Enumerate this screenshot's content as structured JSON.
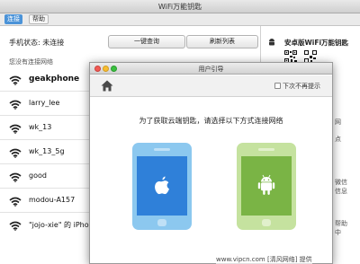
{
  "window": {
    "title": "WiFi万能钥匙"
  },
  "toolbar": {
    "tabs": [
      {
        "label": "连接"
      },
      {
        "label": "帮助"
      }
    ]
  },
  "main": {
    "status_text": "手机状态: 未连接",
    "query_button": "一键查询",
    "refresh_button": "刷新列表",
    "subheading": "您没有连接网络",
    "networks": [
      {
        "ssid": "geakphone"
      },
      {
        "ssid": "larry_lee"
      },
      {
        "ssid": "wk_13"
      },
      {
        "ssid": "wk_13_5g"
      },
      {
        "ssid": "good"
      },
      {
        "ssid": "modou-A157"
      },
      {
        "ssid": "\"jojo-xie\" 的 iPho"
      }
    ]
  },
  "sidebar": {
    "title": "安卓版WiFi万能钥匙",
    "fragments": [
      "网",
      "点",
      "微信",
      "信息",
      "帮助",
      "中"
    ]
  },
  "dialog": {
    "title": "用户引导",
    "dont_show_again": "下次不再提示",
    "instruction": "为了获取云端钥匙，请选择以下方式连接网络"
  },
  "watermark": "www.vipcn.com [清风网络] 提供",
  "colors": {
    "ios_phone": "#2f80d9",
    "android_phone": "#7ab445",
    "active_tab": "#4b93d8"
  }
}
